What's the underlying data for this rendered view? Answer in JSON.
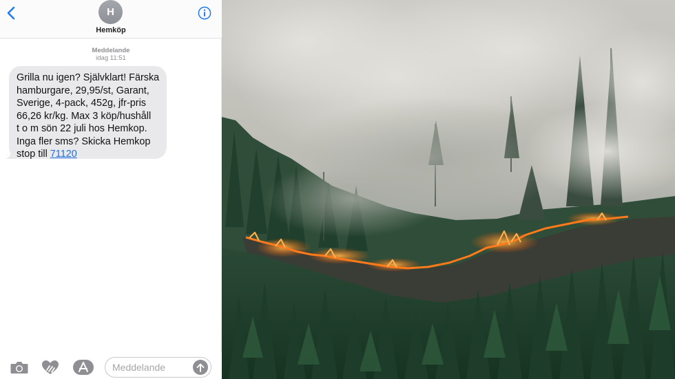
{
  "header": {
    "contact_initial": "H",
    "contact_name": "Hemköp"
  },
  "thread": {
    "meta_kind": "Meddelande",
    "meta_time": "idag 11:51"
  },
  "message": {
    "lines": [
      "Grilla nu igen? Självklart! Färska",
      "hamburgare, 29,95/st, Garant,",
      "Sverige, 4-pack, 452g, jfr-pris",
      "66,26 kr/kg. Max 3 köp/hushåll",
      "t o m sön 22 juli hos Hemkop.",
      "Inga fler sms? Skicka Hemkop"
    ],
    "last_line_prefix": "stop till ",
    "link_number": "71120"
  },
  "composer": {
    "placeholder": "Meddelande"
  },
  "colors": {
    "accent": "#1f6fe0",
    "bubble": "#e9e9eb",
    "fire": "#ff7a1a"
  },
  "icons": [
    "chevron-left-icon",
    "info-icon",
    "camera-icon",
    "digital-touch-heart-icon",
    "app-store-icon",
    "send-arrow-icon"
  ]
}
